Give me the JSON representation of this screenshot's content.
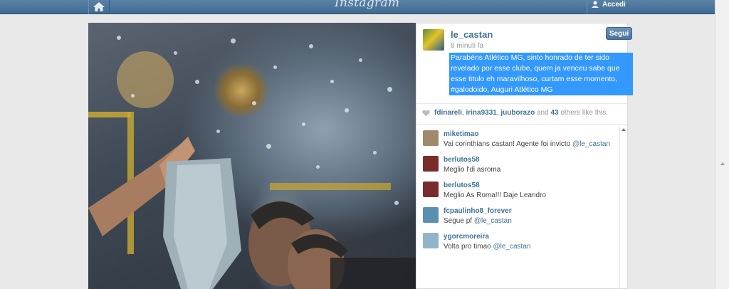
{
  "header": {
    "logo": "Instagram",
    "login_label": "Accedi"
  },
  "post": {
    "username": "le_castan",
    "time": "8 minuti fa",
    "follow_label": "Segui",
    "caption": "Parabéns Atlético MG, sinto honrado de ter sido revelado por esse clube, quem ja venceu sabe que esse titulo eh maravilhoso, curtam esse momento, #galodoido, Auguri Atlético MG",
    "likes": {
      "users": [
        "fdinareli",
        "irina9331",
        "juuborazo"
      ],
      "and": "and",
      "others_count": "43",
      "others_text": "others like this."
    }
  },
  "comments": [
    {
      "user": "miketimao",
      "text": "Vai corinthians castan! Agente foi invicto",
      "mention": "@le_castan",
      "avatar_color": "#a18a6b"
    },
    {
      "user": "berlutos58",
      "text": "Meglio l'di asroma",
      "mention": "",
      "avatar_color": "#7a2c2c"
    },
    {
      "user": "berlutos58",
      "text": "Meglio As Roma!!! Daje Leandro",
      "mention": "",
      "avatar_color": "#7a2c2c"
    },
    {
      "user": "fcpaulinho8_forever",
      "text": "Segue pf",
      "mention": "@le_castan",
      "avatar_color": "#5b8fb0"
    },
    {
      "user": "ygorcmoreira",
      "text": "Volta pro timao",
      "mention": "@le_castan",
      "avatar_color": "#8fb5c8"
    }
  ],
  "icons": {
    "home": "home-icon",
    "user": "user-icon",
    "heart": "heart-icon"
  }
}
